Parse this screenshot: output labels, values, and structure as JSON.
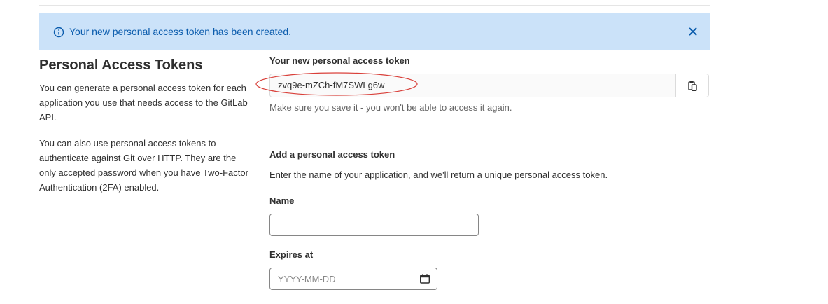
{
  "alert": {
    "message": "Your new personal access token has been created.",
    "info_icon": "info-circle-icon",
    "close_icon": "close-icon",
    "background": "#cbe2f9",
    "text_color": "#0b5cad"
  },
  "sidebar": {
    "title": "Personal Access Tokens",
    "paragraph1": "You can generate a personal access token for each application you use that needs access to the GitLab API.",
    "paragraph2": "You can also use personal access tokens to authenticate against Git over HTTP. They are the only accepted password when you have Two-Factor Authentication (2FA) enabled."
  },
  "new_token": {
    "label": "Your new personal access token",
    "value": "zvq9e-mZCh-fM7SWLg6w",
    "copy_icon": "clipboard-icon",
    "help": "Make sure you save it - you won't be able to access it again.",
    "highlight_color": "#d9403a"
  },
  "add_token": {
    "heading": "Add a personal access token",
    "description": "Enter the name of your application, and we'll return a unique personal access token.",
    "name_label": "Name",
    "name_value": "",
    "expires_label": "Expires at",
    "expires_placeholder": "YYYY-MM-DD",
    "calendar_icon": "calendar-icon"
  }
}
